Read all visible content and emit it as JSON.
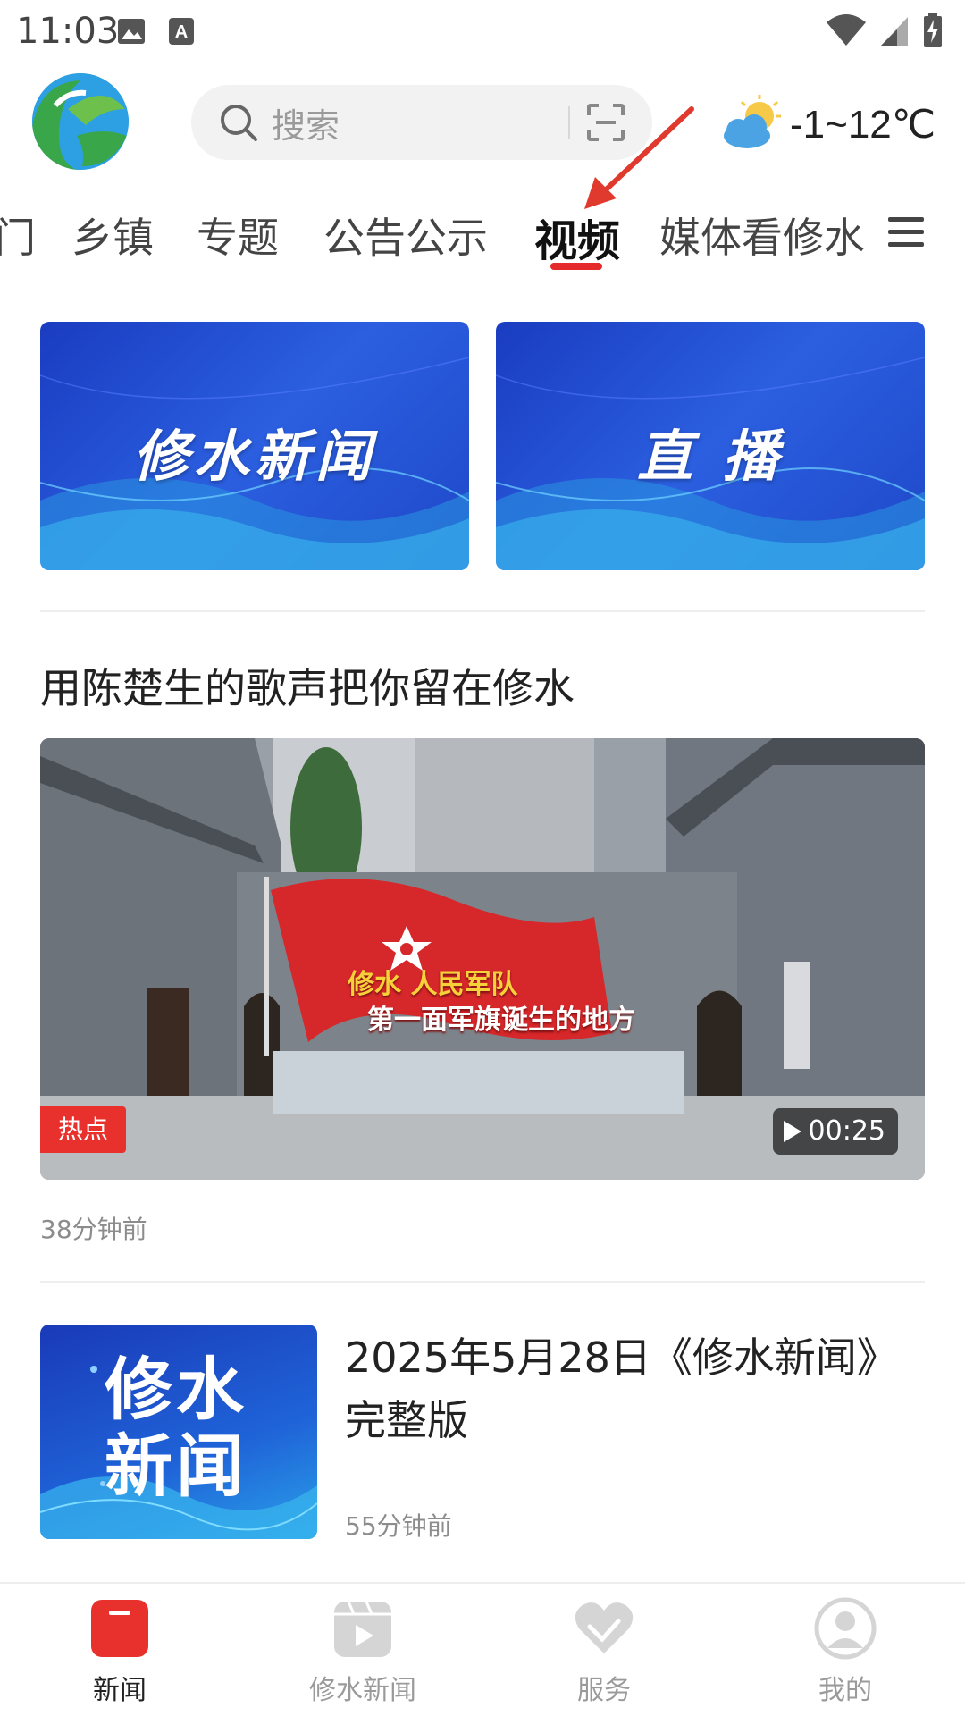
{
  "status_bar": {
    "time": "11:03",
    "icons": [
      "image-icon",
      "a-notification-icon",
      "wifi-icon",
      "signal-icon",
      "battery-charging-icon"
    ]
  },
  "header": {
    "logo": "app-logo",
    "search": {
      "placeholder": "搜索",
      "icon": "search-icon",
      "scan_icon": "scan-icon"
    },
    "weather": {
      "icon": "partly-cloudy-icon",
      "temperature": "-1~12℃"
    }
  },
  "tabs": {
    "items": [
      "门",
      "乡镇",
      "专题",
      "公告公示",
      "视频",
      "媒体看修水"
    ],
    "active": "视频",
    "menu_icon": "menu-icon",
    "accent": "#e42a2a"
  },
  "banners": [
    {
      "label": "修水新闻"
    },
    {
      "label": "直 播"
    }
  ],
  "articles": [
    {
      "title": "用陈楚生的歌声把你留在修水",
      "badge": "热点",
      "duration": "00:25",
      "time": "38分钟前",
      "sign_line1": "修水  人民军队",
      "sign_line2": "第一面军旗诞生的地方"
    },
    {
      "title": "2025年5月28日《修水新闻》完整版",
      "thumb_text": "修水\n新闻",
      "time": "55分钟前"
    }
  ],
  "bottom_nav": {
    "items": [
      {
        "label": "新闻",
        "icon": "news-icon",
        "active": true
      },
      {
        "label": "修水新闻",
        "icon": "video-icon",
        "active": false
      },
      {
        "label": "服务",
        "icon": "service-heart-icon",
        "active": false
      },
      {
        "label": "我的",
        "icon": "user-icon",
        "active": false
      }
    ]
  }
}
